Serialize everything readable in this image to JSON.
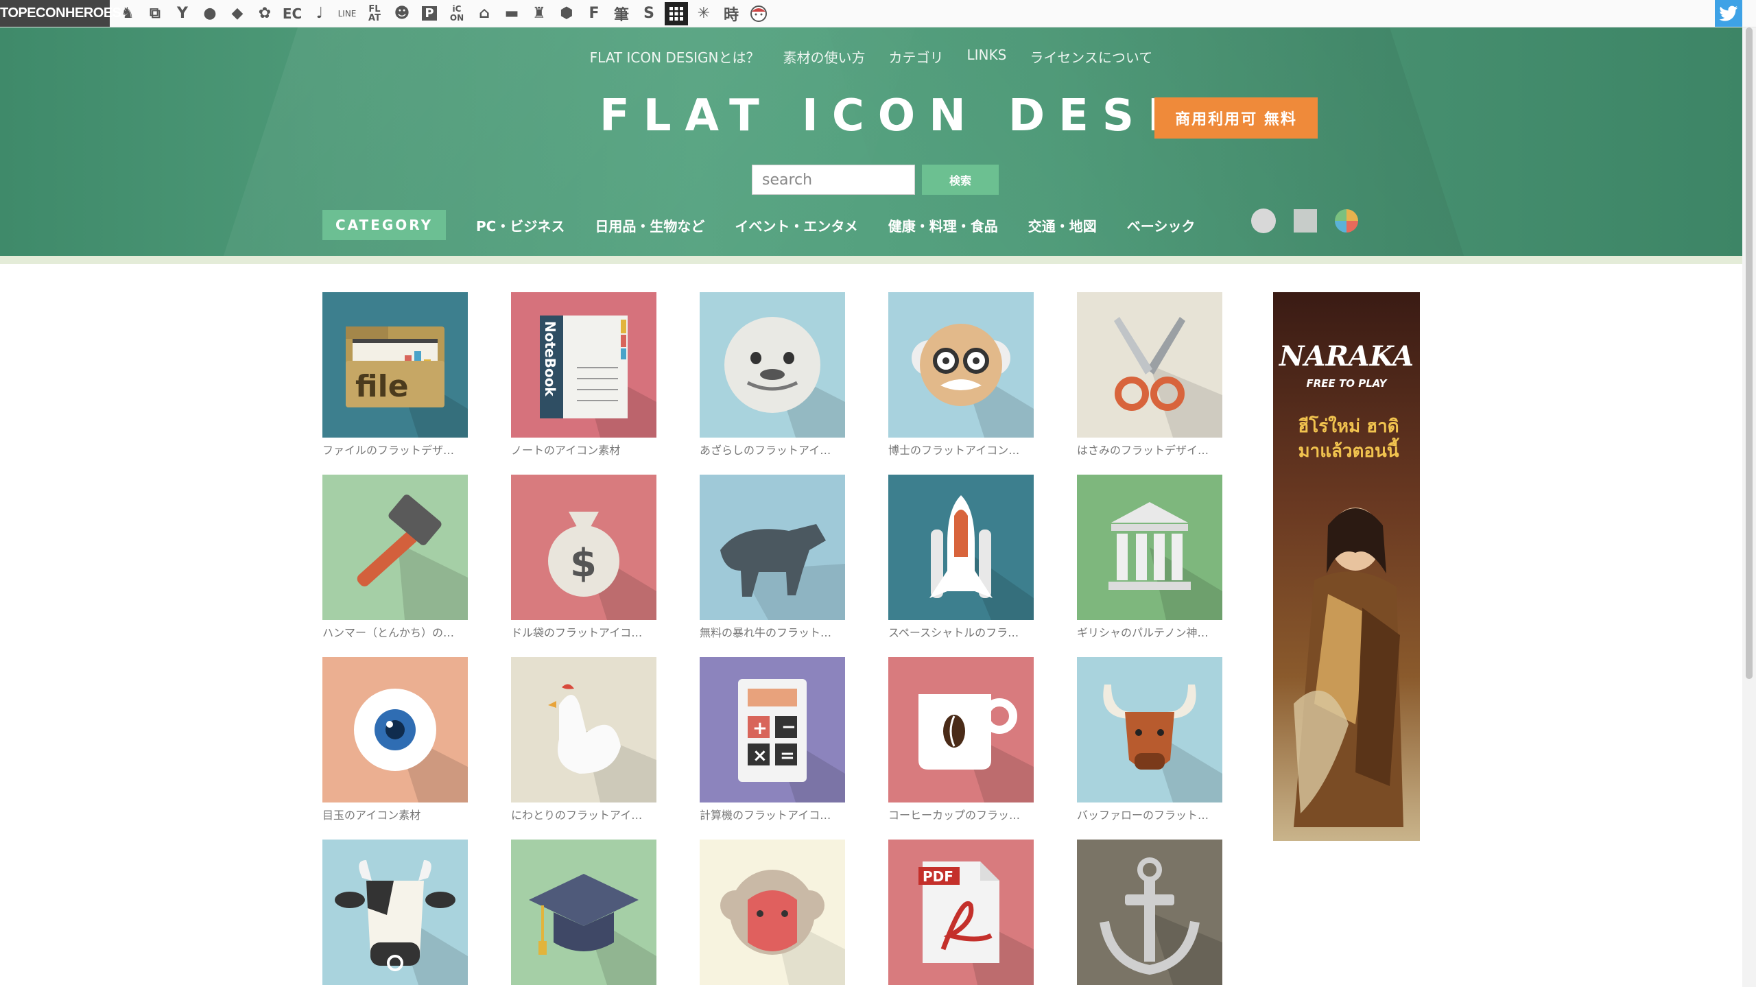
{
  "topbar": {
    "brand": "TOPECONHEROES",
    "icons": [
      "horse-icon",
      "copy-icon",
      "stickman-icon",
      "speech-bubble-icon",
      "tag-icon",
      "flower-icon",
      "ec-icon",
      "music-note-icon",
      "line-icon",
      "flat-icon",
      "smiley-icon",
      "p-icon",
      "icon-on-icon",
      "house-icon",
      "car-icon",
      "person-icon",
      "hexagon-icon",
      "font-f-icon",
      "brush-kanji-icon",
      "s-icon",
      "grid-icon",
      "sparkle-icon",
      "clock-kanji-icon",
      "face-icon"
    ],
    "icon_labels": {
      "ec": "EC",
      "line": "LINE",
      "flat": "FLAT",
      "p": "P",
      "on": "iC ON",
      "fude": "筆",
      "ji": "時",
      "s": "S"
    }
  },
  "nav": {
    "links": [
      "FLAT ICON DESIGNとは？",
      "素材の使い方",
      "カテゴリ",
      "LINKS",
      "ライセンスについて"
    ]
  },
  "header": {
    "title": "FLAT ICON DESIGN",
    "badge": "商用利用可 無料",
    "search_placeholder": "search",
    "search_button": "検索"
  },
  "categories": {
    "label": "CATEGORY",
    "items": [
      "PC・ビジネス",
      "日用品・生物など",
      "イベント・エンタメ",
      "健康・料理・食品",
      "交通・地図",
      "ベーシック"
    ]
  },
  "icons": [
    {
      "caption": "ファイルのフラットデザ…",
      "bg": "#3d7f8e",
      "art": "file"
    },
    {
      "caption": "ノートのアイコン素材",
      "bg": "#d6727c",
      "art": "notebook"
    },
    {
      "caption": "あざらしのフラットアイ…",
      "bg": "#a9d3dd",
      "art": "seal"
    },
    {
      "caption": "博士のフラットアイコン…",
      "bg": "#a8d2de",
      "art": "professor"
    },
    {
      "caption": "はさみのフラットデザイ…",
      "bg": "#e7e3d6",
      "art": "scissors"
    },
    {
      "caption": "ハンマー（とんかち）の…",
      "bg": "#a5cfa6",
      "art": "hammer"
    },
    {
      "caption": "ドル袋のフラットアイコ…",
      "bg": "#d87b7e",
      "art": "moneybag"
    },
    {
      "caption": "無料の暴れ牛のフラット…",
      "bg": "#9fc9d8",
      "art": "bull"
    },
    {
      "caption": "スペースシャトルのフラ…",
      "bg": "#3d7f8e",
      "art": "shuttle"
    },
    {
      "caption": "ギリシャのパルテノン神…",
      "bg": "#7eb77d",
      "art": "temple"
    },
    {
      "caption": "目玉のアイコン素材",
      "bg": "#ebaf91",
      "art": "eye"
    },
    {
      "caption": "にわとりのフラットアイ…",
      "bg": "#e5e0cf",
      "art": "chicken"
    },
    {
      "caption": "計算機のフラットアイコ…",
      "bg": "#8c84bd",
      "art": "calculator"
    },
    {
      "caption": "コーヒーカップのフラッ…",
      "bg": "#d87b7e",
      "art": "coffee"
    },
    {
      "caption": "バッファローのフラット…",
      "bg": "#a9d3dd",
      "art": "buffalo"
    },
    {
      "caption": "",
      "bg": "#a9d3dd",
      "art": "cow"
    },
    {
      "caption": "",
      "bg": "#a5cfa6",
      "art": "gradcap"
    },
    {
      "caption": "",
      "bg": "#f7f3df",
      "art": "monkey"
    },
    {
      "caption": "",
      "bg": "#d87b7e",
      "art": "pdf"
    },
    {
      "caption": "",
      "bg": "#7a7466",
      "art": "anchor"
    }
  ],
  "icon_texts": {
    "file": "file",
    "notebook": "NoteBook",
    "moneybag": "$",
    "pdf": "PDF"
  },
  "ad": {
    "logo": "NARAKA",
    "tagline": "FREE TO PLAY",
    "thai": "ฮีโร่ใหม่ ฮาดิ มาแล้วตอนนี้"
  },
  "colors": {
    "header_green": "#4e9a78",
    "accent_orange": "#ef8a3a",
    "cat_green": "#6cbf93"
  }
}
